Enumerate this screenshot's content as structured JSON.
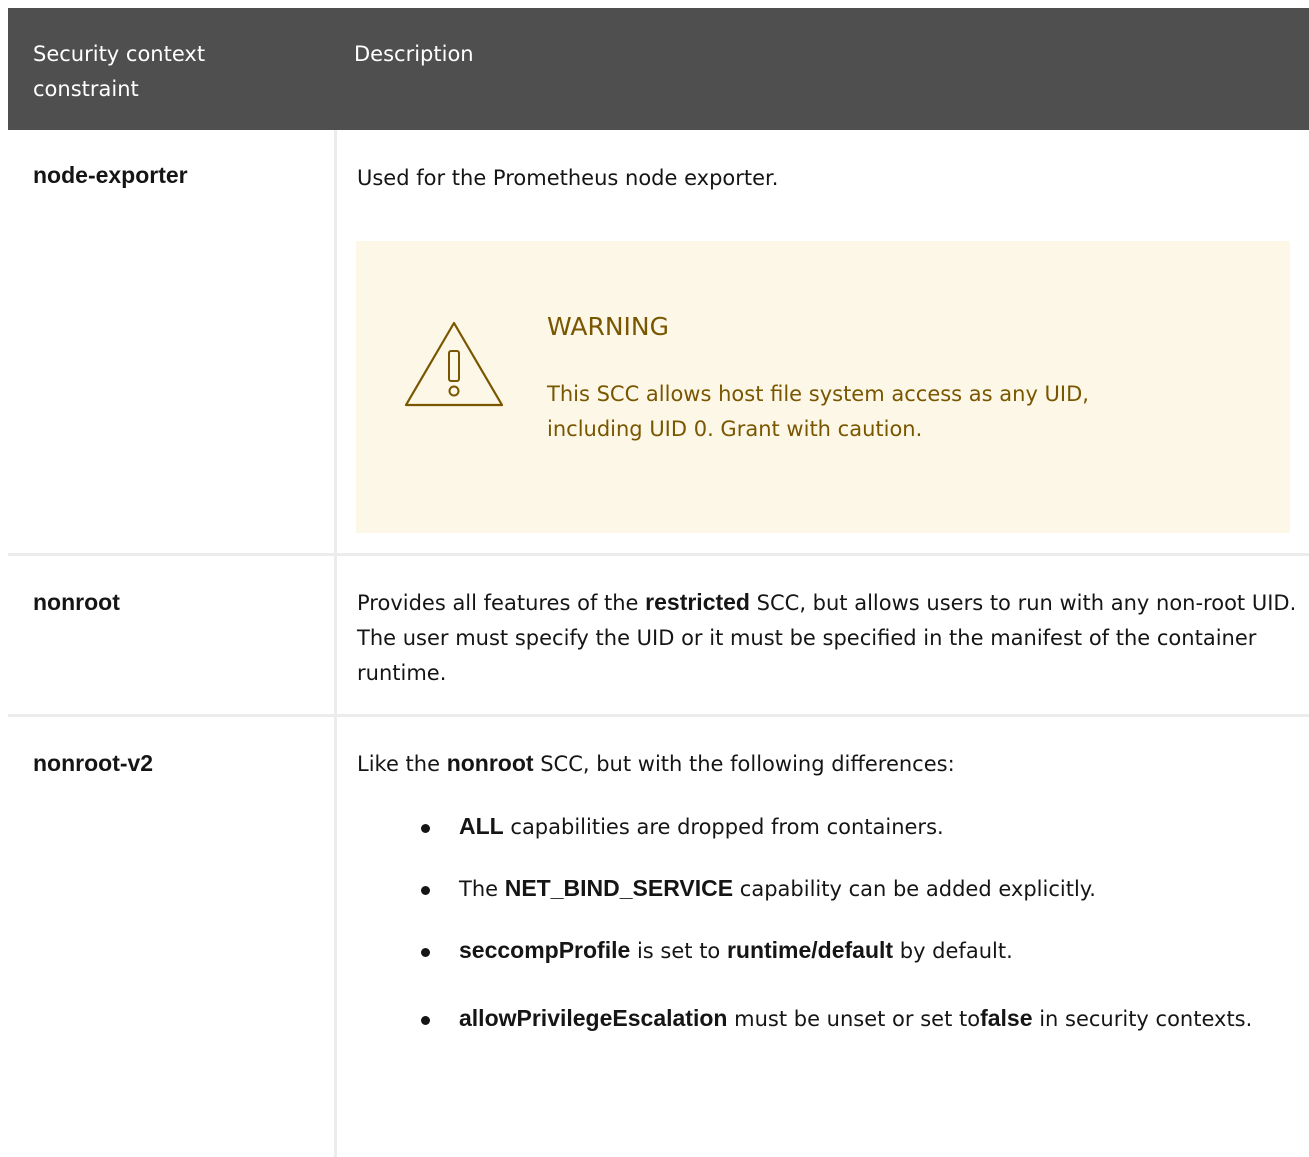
{
  "header": {
    "col1": "Security context constraint",
    "col2": "Description"
  },
  "rows": [
    {
      "name": "node-exporter",
      "description": "Used for the Prometheus node exporter.",
      "warning": {
        "title": "WARNING",
        "text": "This SCC allows host file system access as any UID, including UID 0. Grant with caution."
      }
    },
    {
      "name": "nonroot",
      "desc_pre": "Provides all features of the ",
      "desc_bold": "restricted",
      "desc_post": " SCC, but allows users to run with any non-root UID. The user must specify the UID or it must be specified in the manifest of the container runtime."
    },
    {
      "name": "nonroot-v2",
      "desc_pre": "Like the ",
      "desc_bold": "nonroot",
      "desc_post": " SCC, but with the following differences:",
      "bullets": [
        {
          "b1": "ALL",
          "t1": " capabilities are dropped from containers."
        },
        {
          "t0": "The ",
          "b1": "NET_BIND_SERVICE",
          "t1": " capability can be added explicitly."
        },
        {
          "b1": "seccompProfile",
          "t1": " is set to ",
          "b2": "runtime/default",
          "t2": " by default."
        },
        {
          "b1": "allowPrivilegeEscalation",
          "t1": " must be unset or set to",
          "b2": "false",
          "t2": " in security contexts."
        }
      ]
    }
  ],
  "colors": {
    "header_bg": "#4f4f4f",
    "warning_bg": "#fdf7e7",
    "warning_text": "#795600"
  },
  "icons": {
    "warning": "warning-triangle-icon"
  }
}
